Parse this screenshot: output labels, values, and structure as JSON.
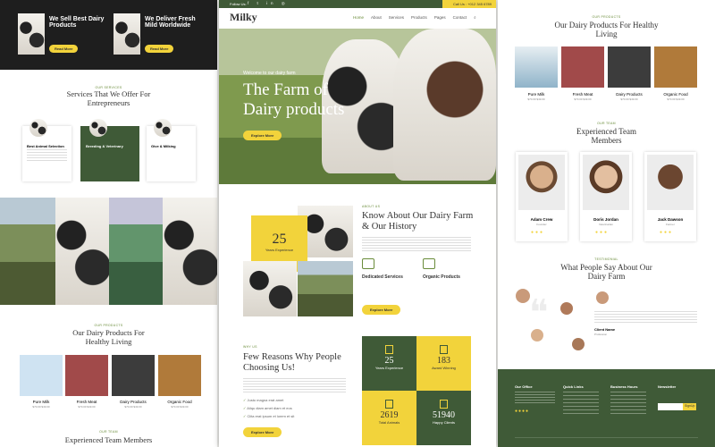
{
  "left": {
    "promo": [
      {
        "title": "We Sell Best Dairy Products",
        "btn": "Read More"
      },
      {
        "title": "We Deliver Fresh Mild Worldwide",
        "btn": "Read More"
      }
    ],
    "services": {
      "kicker": "OUR SERVICES",
      "title": "Services That We Offer For Entrepreneurs",
      "items": [
        "Best Animal Selection",
        "Breeding & Veterinary",
        "Give & Milking"
      ]
    },
    "products": {
      "kicker": "OUR PRODUCTS",
      "title": "Our Dairy Products For Healthy Living",
      "items": [
        {
          "name": "Pure Milk",
          "price": "$70.00 $49.00"
        },
        {
          "name": "Fresh Meat",
          "price": "$70.00 $49.00"
        },
        {
          "name": "Dairy Products",
          "price": "$70.00 $49.00"
        },
        {
          "name": "Organic Food",
          "price": "$70.00 $49.00"
        }
      ]
    },
    "team": {
      "kicker": "OUR TEAM",
      "title": "Experienced Team Members"
    }
  },
  "center": {
    "topbar": {
      "follow": "Follow Us:",
      "call": "Call Us : +012 345 6789"
    },
    "logo": "Milky",
    "nav": [
      "Home",
      "About",
      "Services",
      "Products",
      "Pages",
      "Contact"
    ],
    "hero": {
      "welcome": "Welcome to our dairy farm",
      "title1": "The Farm of",
      "title2": "Dairy products",
      "btn": "Explore More"
    },
    "about": {
      "kicker": "ABOUT US",
      "title": "Know About Our Dairy Farm & Our History",
      "years": "25",
      "years_label": "Years Experience",
      "feat1": "Dedicated Services",
      "feat2": "Organic Products",
      "btn": "Explore More"
    },
    "reasons": {
      "kicker": "WHY US",
      "title": "Few Reasons Why People Choosing Us!",
      "checks": [
        "Justo magna erat amet",
        "Aliqu diam amet diam et eos",
        "Clita erat ipsum et lorem et sit"
      ],
      "btn": "Explore More"
    },
    "stats": [
      {
        "num": "25",
        "label": "Years Experience"
      },
      {
        "num": "183",
        "label": "Award Winning"
      },
      {
        "num": "2619",
        "label": "Total Animals"
      },
      {
        "num": "51940",
        "label": "Happy Clients"
      }
    ]
  },
  "right": {
    "products": {
      "kicker": "OUR PRODUCTS",
      "title": "Our Dairy Products For Healthy Living",
      "items": [
        {
          "name": "Pure Milk",
          "price": "$70.00 $49.00"
        },
        {
          "name": "Fresh Meat",
          "price": "$70.00 $49.00"
        },
        {
          "name": "Dairy Products",
          "price": "$70.00 $49.00"
        },
        {
          "name": "Organic Food",
          "price": "$70.00 $49.00"
        }
      ]
    },
    "team": {
      "kicker": "OUR TEAM",
      "title": "Experienced Team Members",
      "members": [
        {
          "name": "Adam Crew",
          "role": "Founder"
        },
        {
          "name": "Doris Jordan",
          "role": "Veterinarian"
        },
        {
          "name": "Jack Dawson",
          "role": "Farmer"
        }
      ]
    },
    "testimonial": {
      "kicker": "TESTIMONIAL",
      "title": "What People Say About Our Dairy Farm",
      "client": "Client Name",
      "prof": "Profession"
    },
    "footer": {
      "cols": [
        "Our Office",
        "Quick Links",
        "Business Hours",
        "Newsletter"
      ],
      "btn": "SignUp"
    }
  }
}
